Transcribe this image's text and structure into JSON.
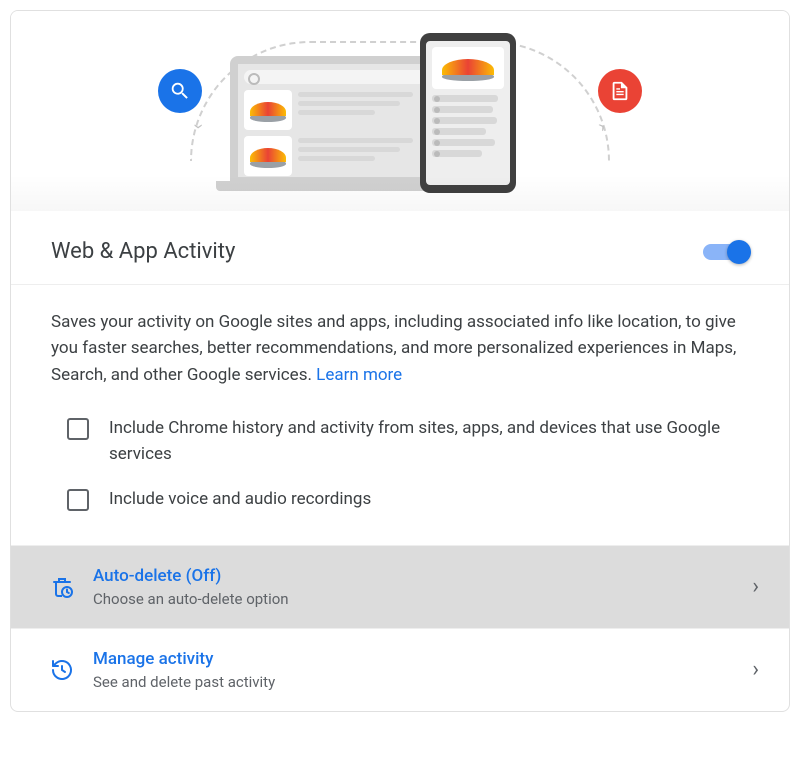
{
  "header": {
    "title": "Web & App Activity",
    "toggle_on": true
  },
  "description": {
    "text": "Saves your activity on Google sites and apps, including associated info like location, to give you faster searches, better recommendations, and more personalized experiences in Maps, Search, and other Google services.",
    "learn_more_label": "Learn more"
  },
  "checkboxes": [
    {
      "label": "Include Chrome history and activity from sites, apps, and devices that use Google services",
      "checked": false
    },
    {
      "label": "Include voice and audio recordings",
      "checked": false
    }
  ],
  "options": {
    "auto_delete": {
      "title": "Auto-delete (Off)",
      "subtitle": "Choose an auto-delete option"
    },
    "manage": {
      "title": "Manage activity",
      "subtitle": "See and delete past activity"
    }
  }
}
